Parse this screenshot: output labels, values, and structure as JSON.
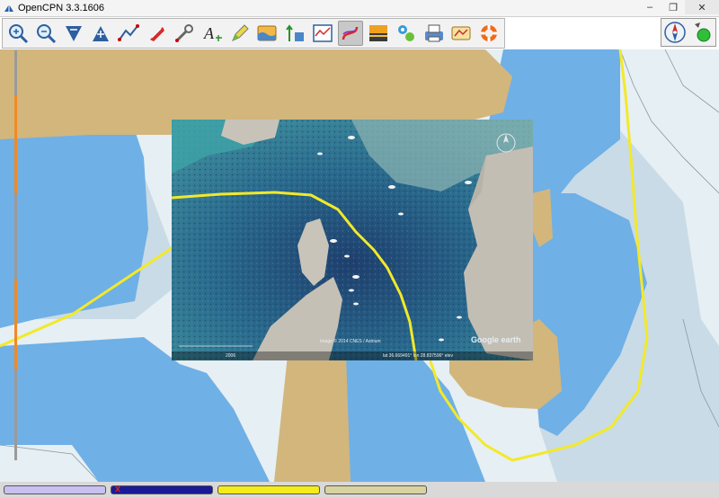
{
  "window": {
    "title": "OpenCPN 3.3.1606"
  },
  "toolbar": {
    "items": [
      {
        "name": "zoom-in",
        "icon": "zoom-in-icon"
      },
      {
        "name": "zoom-out",
        "icon": "zoom-out-icon"
      },
      {
        "name": "scale-down",
        "icon": "scale-down-icon"
      },
      {
        "name": "scale-up",
        "icon": "scale-up-icon"
      },
      {
        "name": "route",
        "icon": "route-icon"
      },
      {
        "name": "follow",
        "icon": "boat-follow-icon"
      },
      {
        "name": "settings",
        "icon": "wrench-icon"
      },
      {
        "name": "text",
        "icon": "text-icon"
      },
      {
        "name": "current",
        "icon": "pencil-icon"
      },
      {
        "name": "tide",
        "icon": "tide-icon"
      },
      {
        "name": "current-arrows",
        "icon": "current-icon"
      },
      {
        "name": "quilt",
        "icon": "chart-quilt-icon"
      },
      {
        "name": "track",
        "icon": "track-icon"
      },
      {
        "name": "color-scheme",
        "icon": "dusk-icon"
      },
      {
        "name": "ais",
        "icon": "ais-icon"
      },
      {
        "name": "print",
        "icon": "print-icon"
      },
      {
        "name": "route-manager",
        "icon": "route-manager-icon"
      },
      {
        "name": "mob",
        "icon": "life-ring-icon"
      }
    ]
  },
  "satellite": {
    "caption_copyright": "Image © 2014 CNES / Astrium",
    "caption_year": "2006",
    "caption_coords": "lat  36.669491°  lon  28.837596°  elev",
    "caption_logo": "Google earth"
  },
  "colors": {
    "land": "#d2b67c",
    "deep": "#e6eff3",
    "medium": "#c9dbe6",
    "shallow": "#6fb0e6",
    "track": "#f2e92a"
  },
  "piano": {
    "keys": [
      {
        "color": "#c8c0f0"
      },
      {
        "color": "#1a1a96",
        "mark": "x"
      },
      {
        "color": "#f3ec1a"
      },
      {
        "color": "#d8d2a0"
      }
    ]
  }
}
